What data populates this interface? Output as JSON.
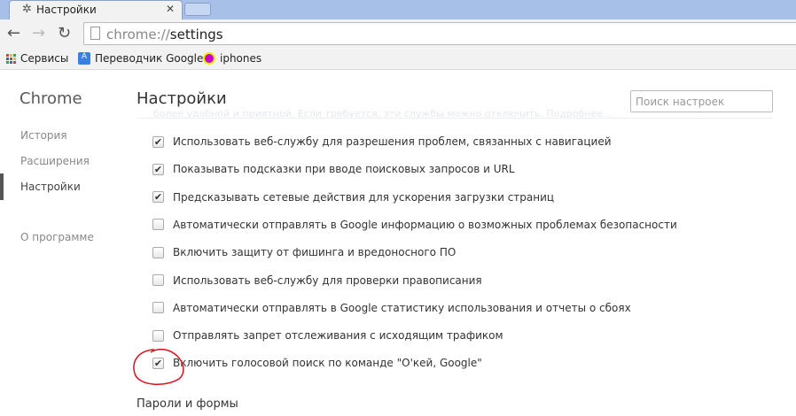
{
  "tab": {
    "title": "Настройки",
    "icon": "gear-icon",
    "close": "✕"
  },
  "toolbar": {
    "url_scheme": "chrome://",
    "url_path": "settings"
  },
  "bookmarks": [
    {
      "label": "Сервисы",
      "icon": "apps-icon"
    },
    {
      "label": "Переводчик Google",
      "icon": "translate-icon"
    },
    {
      "label": "iphones",
      "icon": "iphones-icon"
    }
  ],
  "sidebar": {
    "title": "Chrome",
    "items": [
      {
        "label": "История"
      },
      {
        "label": "Расширения"
      },
      {
        "label": "Настройки",
        "active": true
      },
      {
        "label": "О программе"
      }
    ]
  },
  "main": {
    "title": "Настройки",
    "search_placeholder": "Поиск настроек",
    "ghost_text": "более удобной и приятной. Если требуется, эти службы можно отключить.",
    "ghost_link": "Подробнее...",
    "options": [
      {
        "label": "Использовать веб-службу для разрешения проблем, связанных с навигацией",
        "checked": true
      },
      {
        "label": "Показывать подсказки при вводе поисковых запросов и URL",
        "checked": true
      },
      {
        "label": "Предсказывать сетевые действия для ускорения загрузки страниц",
        "checked": true
      },
      {
        "label": "Автоматически отправлять в Google информацию о возможных проблемах безопасности",
        "checked": false
      },
      {
        "label": "Включить защиту от фишинга и вредоносного ПО",
        "checked": false
      },
      {
        "label": "Использовать веб-службу для проверки правописания",
        "checked": false
      },
      {
        "label": "Автоматически отправлять в Google статистику использования и отчеты о сбоях",
        "checked": false
      },
      {
        "label": "Отправлять запрет отслеживания с исходящим трафиком",
        "checked": false
      },
      {
        "label": "Включить голосовой поиск по команде \"О'кей, Google\"",
        "checked": true
      }
    ],
    "section": "Пароли и формы"
  },
  "colors": {
    "annotation": "#e0101a"
  }
}
